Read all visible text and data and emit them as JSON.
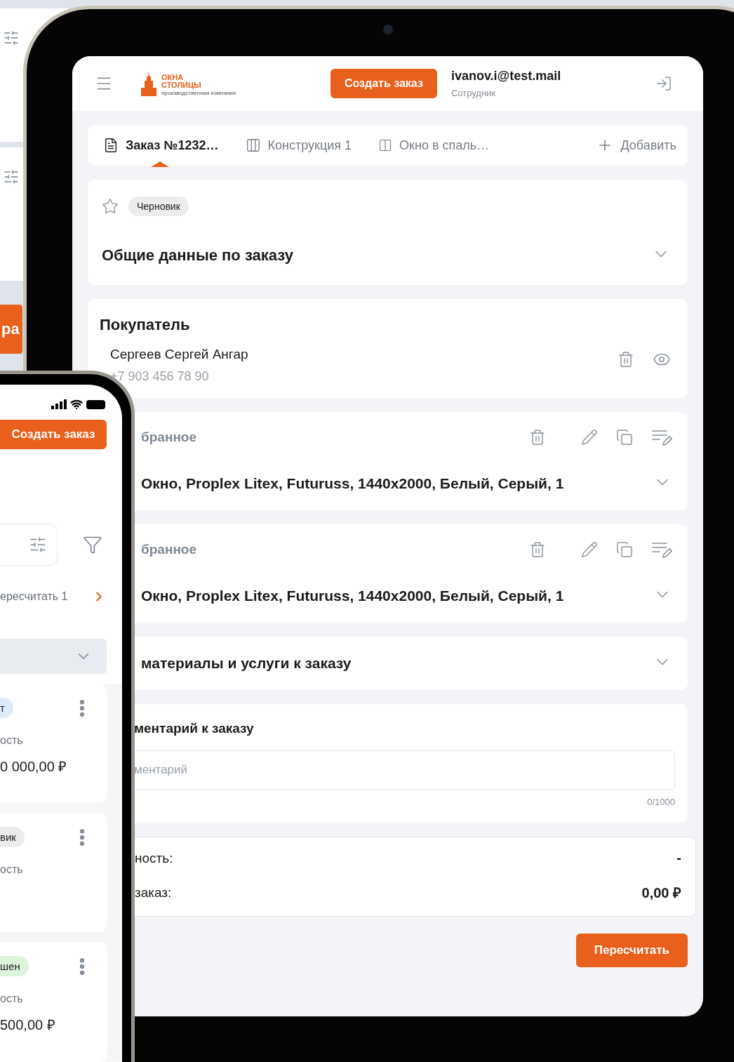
{
  "background_app": {
    "button_label": "ра"
  },
  "tablet": {
    "header": {
      "brand_line1": "ОКНА",
      "brand_line2": "СТОЛИЦЫ",
      "brand_tagline": "производственная компания",
      "create_button": "Создать заказ",
      "user_email": "ivanov.i@test.mail",
      "user_role": "Сотрудник"
    },
    "tabs": [
      {
        "kind": "document",
        "label": "Заказ №1232…",
        "selected": true
      },
      {
        "kind": "construction",
        "label": "Конструкция 1",
        "selected": false
      },
      {
        "kind": "window",
        "label": "Окно в спаль…",
        "selected": false
      }
    ],
    "add_tab": "Добавить",
    "general": {
      "favorite": false,
      "status": "Черновик",
      "title": "Общие данные по заказу",
      "expanded": false
    },
    "buyer": {
      "title": "Покупатель",
      "name": "Сергеев Сергей Ангар",
      "phone": "+7 903 456 78 90"
    },
    "constructions": [
      {
        "label": "бранное",
        "title": "Окно, Proplex Litex, Futuruss, 1440x2000, Белый, Серый, 1",
        "expanded": false
      },
      {
        "label": "бранное",
        "title": "Окно, Proplex Litex, Futuruss, 1440x2000, Белый, Серый, 1",
        "expanded": false
      }
    ],
    "materials": {
      "title": "материалы и услуги к заказу",
      "expanded": false
    },
    "comment": {
      "title": "ментарий к заказу",
      "placeholder": "ментарий",
      "counter": "0/1000"
    },
    "totals": [
      {
        "label": "ность:",
        "value": "-"
      },
      {
        "label": "заказ:",
        "value": "0,00 ₽"
      }
    ],
    "recalc_button": "Пересчитать"
  },
  "phone": {
    "create_button": "Создать заказ",
    "recalc_notice": "ересчитать 1",
    "orders": [
      {
        "status": "т",
        "color": "#dcebfb",
        "label": "ость",
        "amount": "0 000,00 ₽"
      },
      {
        "status": "вик",
        "color": "#ebebeb",
        "label": "ость"
      },
      {
        "status": "шен",
        "color": "#dcf3dc",
        "label": "ость",
        "amount": "500,00 ₽"
      }
    ]
  }
}
